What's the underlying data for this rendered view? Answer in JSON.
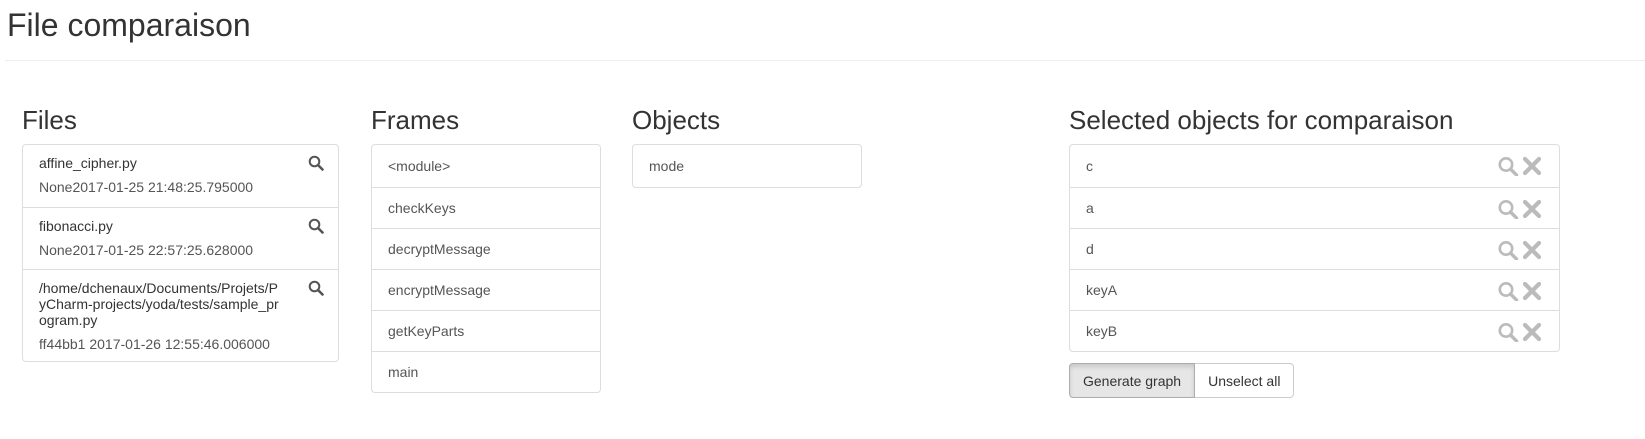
{
  "page": {
    "title": "File comparaison"
  },
  "files": {
    "heading": "Files",
    "items": [
      {
        "name": "affine_cipher.py",
        "meta": "None2017-01-25 21:48:25.795000"
      },
      {
        "name": "fibonacci.py",
        "meta": "None2017-01-25 22:57:25.628000"
      },
      {
        "name": "/home/dchenaux/Documents/Projets/PyCharm-projects/yoda/tests/sample_program.py",
        "meta": "ff44bb1 2017-01-26 12:55:46.006000"
      }
    ]
  },
  "frames": {
    "heading": "Frames",
    "items": [
      "<module>",
      "checkKeys",
      "decryptMessage",
      "encryptMessage",
      "getKeyParts",
      "main"
    ]
  },
  "objects": {
    "heading": "Objects",
    "items": [
      "mode"
    ]
  },
  "selected": {
    "heading": "Selected objects for comparaison",
    "items": [
      "c",
      "a",
      "d",
      "keyA",
      "keyB"
    ],
    "generate_label": "Generate graph",
    "unselect_label": "Unselect all"
  },
  "icons": {
    "search": "search-icon",
    "remove": "remove-icon"
  },
  "colors": {
    "border": "#dddddd",
    "icon": "#555555",
    "muted_icon": "#bbbbbb"
  }
}
